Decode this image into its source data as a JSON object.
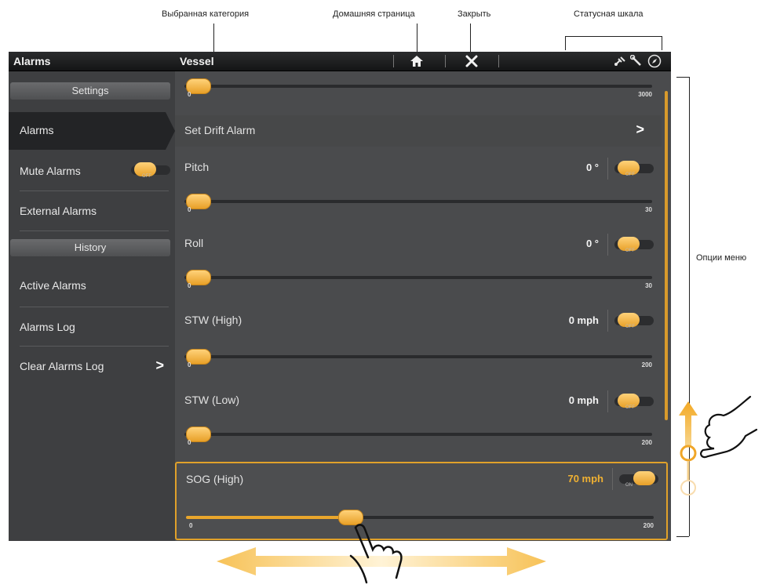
{
  "callouts": {
    "selected_category": "Выбранная категория",
    "home_page": "Домашняя страница",
    "close": "Закрыть",
    "status_bar": "Статусная шкала",
    "menu_options": "Опции меню"
  },
  "topbar": {
    "left_title": "Alarms",
    "category": "Vessel",
    "home_icon": "home-icon",
    "close_icon": "close-icon",
    "status_icons": [
      "satellite-icon",
      "wrench-icon",
      "compass-icon"
    ]
  },
  "sidebar": {
    "settings_header": "Settings",
    "history_header": "History",
    "items": [
      {
        "label": "Alarms",
        "active": true
      },
      {
        "label": "Mute Alarms",
        "toggle": true
      },
      {
        "label": "External Alarms"
      },
      {
        "label": "Active Alarms"
      },
      {
        "label": "Alarms Log"
      },
      {
        "label": "Clear Alarms Log",
        "arrow": ">"
      }
    ]
  },
  "main": {
    "top_slider": {
      "min": "0",
      "max": "3000",
      "value": 0
    },
    "drift_alarm": {
      "label": "Set Drift Alarm",
      "arrow": ">"
    },
    "pitch": {
      "label": "Pitch",
      "value": "0 °",
      "min": "0",
      "max": "30",
      "slider_value": 0
    },
    "roll": {
      "label": "Roll",
      "value": "0 °",
      "min": "0",
      "max": "30",
      "slider_value": 0
    },
    "stw_high": {
      "label": "STW (High)",
      "value": "0 mph",
      "min": "0",
      "max": "200",
      "slider_value": 0
    },
    "stw_low": {
      "label": "STW (Low)",
      "value": "0 mph",
      "min": "0",
      "max": "200",
      "slider_value": 0
    },
    "sog_high": {
      "label": "SOG (High)",
      "value": "70 mph",
      "min": "0",
      "max": "200",
      "slider_value": 70
    },
    "toggle_off": "OFF",
    "toggle_on": "ON"
  },
  "colors": {
    "accent": "#e9a62c",
    "background": "#4a4b4d",
    "topbar": "#1c1d1f"
  }
}
